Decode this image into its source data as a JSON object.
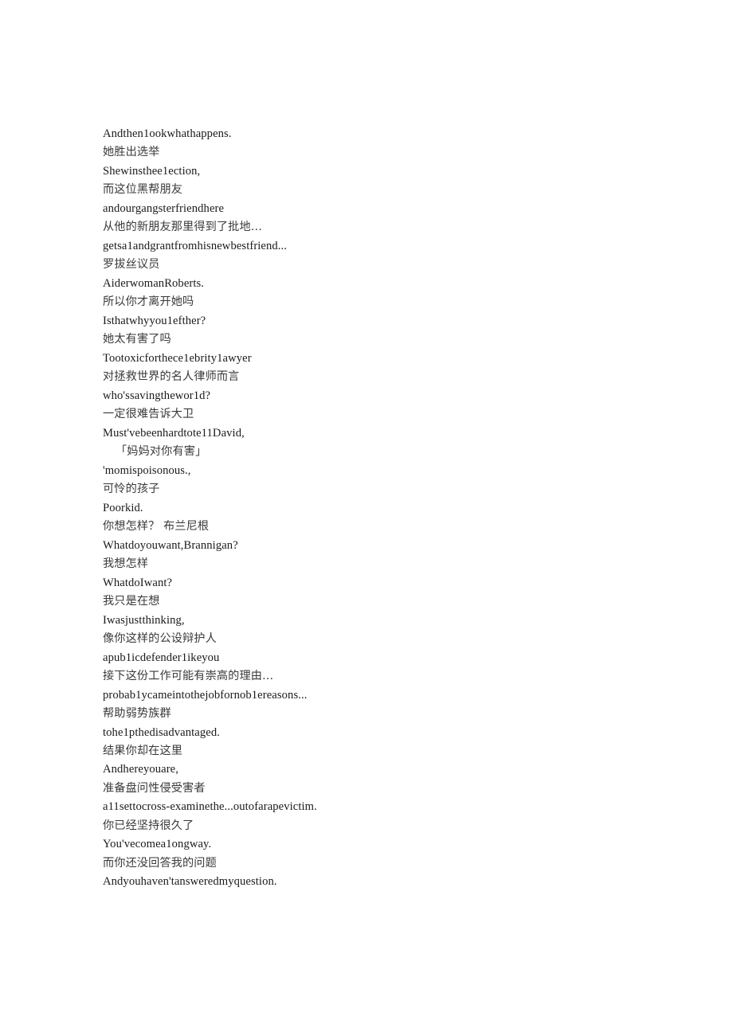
{
  "document": {
    "type": "bilingual-subtitle-transcript",
    "background_color": "#ffffff",
    "text_color_latin": "#1a1a1a",
    "text_color_cjk": "#3a3a3a",
    "lines": [
      {
        "lang": "en",
        "text": "Andthen1ookwhathappens."
      },
      {
        "lang": "zh",
        "text": "她胜出选举"
      },
      {
        "lang": "en",
        "text": "Shewinsthee1ection,"
      },
      {
        "lang": "zh",
        "text": "而这位黑帮朋友"
      },
      {
        "lang": "en",
        "text": "andourgangsterfriendhere"
      },
      {
        "lang": "zh",
        "text": "从他的新朋友那里得到了批地…"
      },
      {
        "lang": "en",
        "text": "getsa1andgrantfromhisnewbestfriend..."
      },
      {
        "lang": "zh",
        "text": "罗拔丝议员"
      },
      {
        "lang": "en",
        "text": "AiderwomanRoberts."
      },
      {
        "lang": "zh",
        "text": "所以你才离开她吗"
      },
      {
        "lang": "en",
        "text": "Isthatwhyyou1efther?"
      },
      {
        "lang": "zh",
        "text": "她太有害了吗"
      },
      {
        "lang": "en",
        "text": "Tootoxicforthece1ebrity1awyer"
      },
      {
        "lang": "zh",
        "text": "对拯救世界的名人律师而言"
      },
      {
        "lang": "en",
        "text": "who'ssavingthewor1d?"
      },
      {
        "lang": "zh",
        "text": "一定很难告诉大卫"
      },
      {
        "lang": "en",
        "text": "Must'vebeenhardtote11David,"
      },
      {
        "lang": "zh",
        "text": "「妈妈对你有害」",
        "indent": true
      },
      {
        "lang": "en",
        "text": "'momispoisonous.,"
      },
      {
        "lang": "zh",
        "text": "可怜的孩子"
      },
      {
        "lang": "en",
        "text": "Poorkid."
      },
      {
        "lang": "zh",
        "text": "你想怎样？ 布兰尼根"
      },
      {
        "lang": "en",
        "text": "Whatdoyouwant,Brannigan?"
      },
      {
        "lang": "zh",
        "text": "我想怎样"
      },
      {
        "lang": "en",
        "text": "WhatdoIwant?"
      },
      {
        "lang": "zh",
        "text": "我只是在想"
      },
      {
        "lang": "en",
        "text": "Iwasjustthinking,"
      },
      {
        "lang": "zh",
        "text": "像你这样的公设辩护人"
      },
      {
        "lang": "en",
        "text": "apub1icdefender1ikeyou"
      },
      {
        "lang": "zh",
        "text": "接下这份工作可能有崇高的理由…"
      },
      {
        "lang": "en",
        "text": "probab1ycameintothejobfornob1ereasons..."
      },
      {
        "lang": "zh",
        "text": "帮助弱势族群"
      },
      {
        "lang": "en",
        "text": "tohe1pthedisadvantaged."
      },
      {
        "lang": "zh",
        "text": "结果你却在这里"
      },
      {
        "lang": "en",
        "text": "Andhereyouare,"
      },
      {
        "lang": "zh",
        "text": "准备盘问性侵受害者"
      },
      {
        "lang": "en",
        "text": "a11settocross-examinethe...outofarapevictim."
      },
      {
        "lang": "zh",
        "text": "你已经坚持很久了"
      },
      {
        "lang": "en",
        "text": "You'vecomea1ongway."
      },
      {
        "lang": "zh",
        "text": "而你还没回答我的问题"
      },
      {
        "lang": "en",
        "text": "Andyouhaven'tansweredmyquestion."
      }
    ]
  }
}
